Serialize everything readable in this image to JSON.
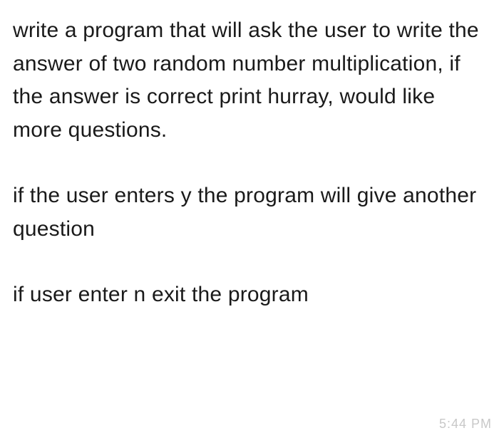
{
  "paragraphs": [
    "write a program that will ask the user to write the answer of two random number multiplication, if the answer is correct print hurray, would like more questions.",
    "if the user enters y the program will give another question",
    "if user enter n exit the program"
  ],
  "timestamp": "5:44 PM"
}
